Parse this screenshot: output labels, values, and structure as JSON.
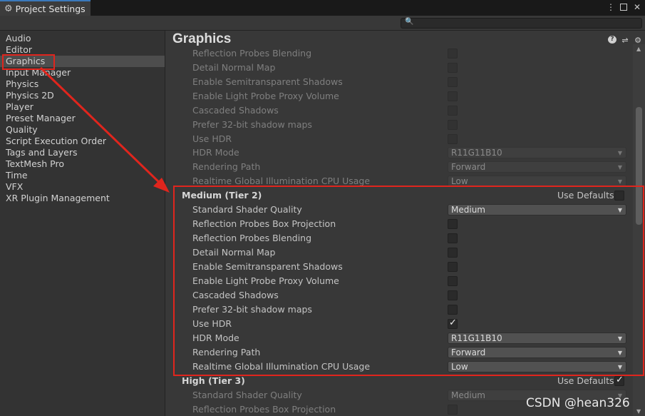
{
  "window": {
    "tab_title": "Project Settings",
    "tab_icon": "gear-icon",
    "menu_icon": "⋮",
    "close_icon": "✕"
  },
  "search": {
    "placeholder": ""
  },
  "sidebar": {
    "items": [
      {
        "label": "Audio"
      },
      {
        "label": "Editor"
      },
      {
        "label": "Graphics"
      },
      {
        "label": "Input Manager"
      },
      {
        "label": "Physics"
      },
      {
        "label": "Physics 2D"
      },
      {
        "label": "Player"
      },
      {
        "label": "Preset Manager"
      },
      {
        "label": "Quality"
      },
      {
        "label": "Script Execution Order"
      },
      {
        "label": "Tags and Layers"
      },
      {
        "label": "TextMesh Pro"
      },
      {
        "label": "Time"
      },
      {
        "label": "VFX"
      },
      {
        "label": "XR Plugin Management"
      }
    ],
    "selected": "Graphics"
  },
  "main": {
    "title": "Graphics",
    "low_tier_rows": [
      {
        "label": "Reflection Probes Blending",
        "type": "checkbox"
      },
      {
        "label": "Detail Normal Map",
        "type": "checkbox"
      },
      {
        "label": "Enable Semitransparent Shadows",
        "type": "checkbox"
      },
      {
        "label": "Enable Light Probe Proxy Volume",
        "type": "checkbox"
      },
      {
        "label": "Cascaded Shadows",
        "type": "checkbox"
      },
      {
        "label": "Prefer 32-bit shadow maps",
        "type": "checkbox"
      },
      {
        "label": "Use HDR",
        "type": "checkbox"
      },
      {
        "label": "HDR Mode",
        "type": "dropdown",
        "value": "R11G11B10"
      },
      {
        "label": "Rendering Path",
        "type": "dropdown",
        "value": "Forward"
      },
      {
        "label": "Realtime Global Illumination CPU Usage",
        "type": "dropdown",
        "value": "Low"
      }
    ],
    "medium_tier": {
      "header": "Medium (Tier 2)",
      "use_defaults_label": "Use Defaults",
      "rows": [
        {
          "label": "Standard Shader Quality",
          "type": "dropdown",
          "value": "Medium"
        },
        {
          "label": "Reflection Probes Box Projection",
          "type": "checkbox",
          "checked": false
        },
        {
          "label": "Reflection Probes Blending",
          "type": "checkbox",
          "checked": false
        },
        {
          "label": "Detail Normal Map",
          "type": "checkbox",
          "checked": false
        },
        {
          "label": "Enable Semitransparent Shadows",
          "type": "checkbox",
          "checked": false
        },
        {
          "label": "Enable Light Probe Proxy Volume",
          "type": "checkbox",
          "checked": false
        },
        {
          "label": "Cascaded Shadows",
          "type": "checkbox",
          "checked": false
        },
        {
          "label": "Prefer 32-bit shadow maps",
          "type": "checkbox",
          "checked": false
        },
        {
          "label": "Use HDR",
          "type": "checkbox",
          "checked": true
        },
        {
          "label": "HDR Mode",
          "type": "dropdown",
          "value": "R11G11B10"
        },
        {
          "label": "Rendering Path",
          "type": "dropdown",
          "value": "Forward"
        },
        {
          "label": "Realtime Global Illumination CPU Usage",
          "type": "dropdown",
          "value": "Low"
        }
      ]
    },
    "high_tier": {
      "header": "High (Tier 3)",
      "use_defaults_label": "Use Defaults",
      "rows": [
        {
          "label": "Standard Shader Quality",
          "type": "dropdown",
          "value": "Medium"
        },
        {
          "label": "Reflection Probes Box Projection",
          "type": "checkbox"
        }
      ]
    }
  },
  "annotation": {
    "color": "#e0251d",
    "watermark": "CSDN @hean326"
  }
}
